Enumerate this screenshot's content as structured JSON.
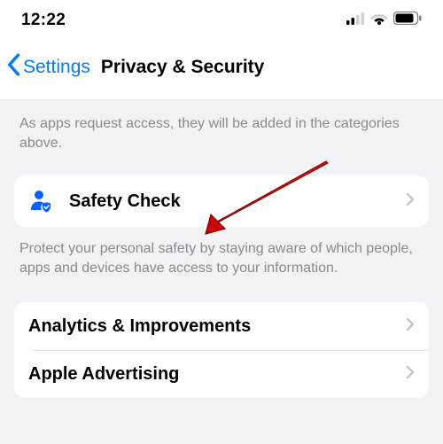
{
  "status_bar": {
    "time": "12:22"
  },
  "nav": {
    "back_label": "Settings",
    "title": "Privacy & Security"
  },
  "sections": {
    "access_footer": "As apps request access, they will be added in the categories above.",
    "safety_check": {
      "label": "Safety Check",
      "footer": "Protect your personal safety by staying aware of which people, apps and devices have access to your information."
    },
    "analytics": {
      "label": "Analytics & Improvements"
    },
    "advertising": {
      "label": "Apple Advertising"
    }
  }
}
